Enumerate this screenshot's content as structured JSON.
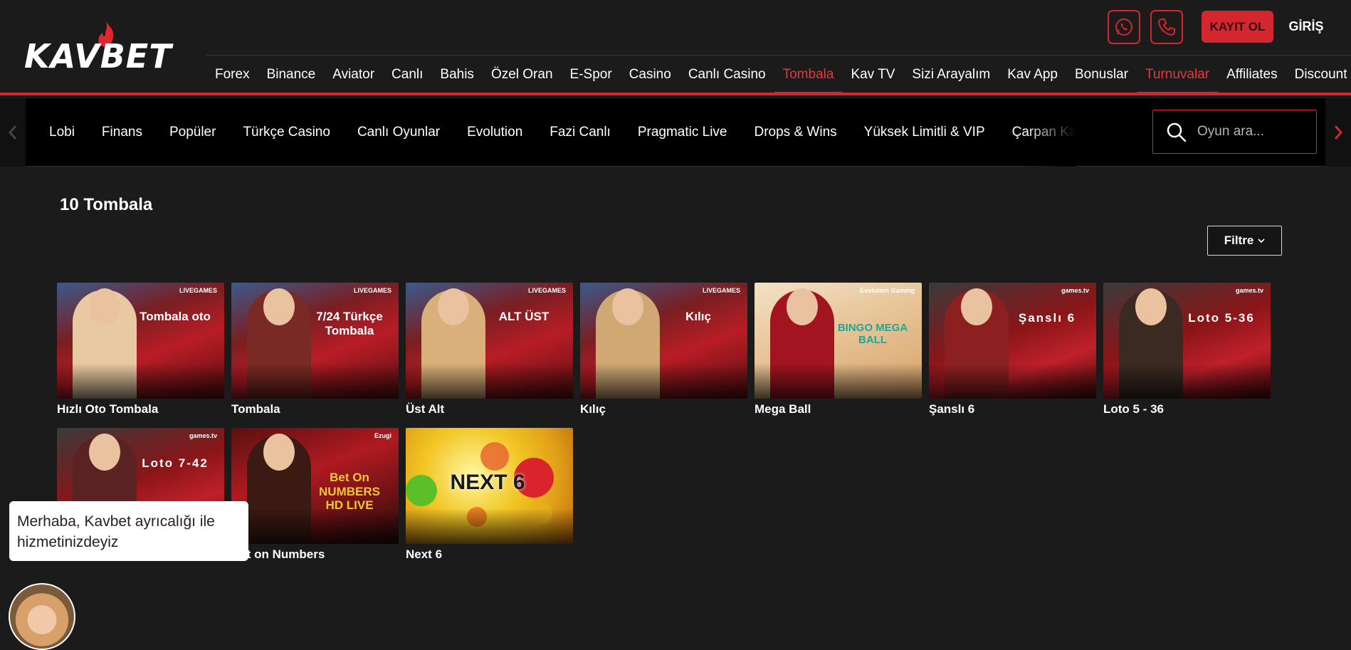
{
  "header": {
    "logo_text": "KAVBET",
    "register_label": "KAYIT OL",
    "login_label": "GİRİŞ",
    "whatsapp_icon": "whatsapp-icon",
    "phone_icon": "phone-icon",
    "accent_color": "#d3262e"
  },
  "topnav": {
    "items": [
      {
        "label": "Forex"
      },
      {
        "label": "Binance"
      },
      {
        "label": "Aviator"
      },
      {
        "label": "Canlı"
      },
      {
        "label": "Bahis"
      },
      {
        "label": "Özel Oran"
      },
      {
        "label": "E-Spor"
      },
      {
        "label": "Casino"
      },
      {
        "label": "Canlı Casino"
      },
      {
        "label": "Tombala",
        "active": true
      },
      {
        "label": "Kav TV"
      },
      {
        "label": "Sizi Arayalım"
      },
      {
        "label": "Kav App"
      },
      {
        "label": "Bonuslar"
      },
      {
        "label": "Turnuvalar",
        "active": true
      },
      {
        "label": "Affiliates"
      },
      {
        "label": "Discount"
      }
    ]
  },
  "subnav": {
    "categories": [
      {
        "label": "Lobi"
      },
      {
        "label": "Finans"
      },
      {
        "label": "Popüler"
      },
      {
        "label": "Türkçe Casino"
      },
      {
        "label": "Canlı Oyunlar"
      },
      {
        "label": "Evolution"
      },
      {
        "label": "Fazi Canlı"
      },
      {
        "label": "Pragmatic Live"
      },
      {
        "label": "Drops & Wins"
      },
      {
        "label": "Yüksek Limitli & VIP"
      },
      {
        "label": "Çarpan Kazancı"
      }
    ],
    "search_placeholder": "Oyun ara..."
  },
  "main": {
    "title": "10 Tombala",
    "filter_label": "Filtre",
    "games": [
      {
        "name": "Hızlı Oto Tombala",
        "brand": "LIVEGAMES",
        "label": "Tombala oto",
        "style": "red-casino",
        "figure": "#e8c9a2"
      },
      {
        "name": "Tombala",
        "brand": "LIVEGAMES",
        "label": "7/24 Türkçe Tombala",
        "style": "red-casino",
        "figure": "#7a2a24"
      },
      {
        "name": "Üst Alt",
        "brand": "LIVEGAMES",
        "label": "ALT ÜST",
        "style": "red-casino",
        "figure": "#d9b07a"
      },
      {
        "name": "Kılıç",
        "brand": "LIVEGAMES",
        "label": "Kılıç",
        "style": "red-casino",
        "figure": "#cfa874"
      },
      {
        "name": "Mega Ball",
        "brand": "Evolution Gaming",
        "label": "BINGO MEGA BALL",
        "style": "evolution",
        "figure": "#a11420"
      },
      {
        "name": "Şanslı 6",
        "brand": "games.tv",
        "label": "Şanslı 6",
        "style": "betgames",
        "figure": "#8c2020"
      },
      {
        "name": "Loto 5 - 36",
        "brand": "games.tv",
        "label": "Loto 5-36",
        "style": "betgames",
        "figure": "#3a2a22"
      },
      {
        "name": "Loto 7 - 42",
        "brand": "games.tv",
        "label": "Loto 7-42",
        "style": "betgames",
        "figure": "#5a2222"
      },
      {
        "name": "Bet on Numbers",
        "brand": "Ezugi",
        "label": "Bet On NUMBERS HD LIVE",
        "style": "ezugi",
        "figure": "#3a1a12"
      },
      {
        "name": "Next 6",
        "brand": "",
        "label": "NEXT 6",
        "style": "next6",
        "figure": ""
      }
    ]
  },
  "chat": {
    "message": "Merhaba, Kavbet ayrıcalığı ile hizmetinizdeyiz"
  }
}
